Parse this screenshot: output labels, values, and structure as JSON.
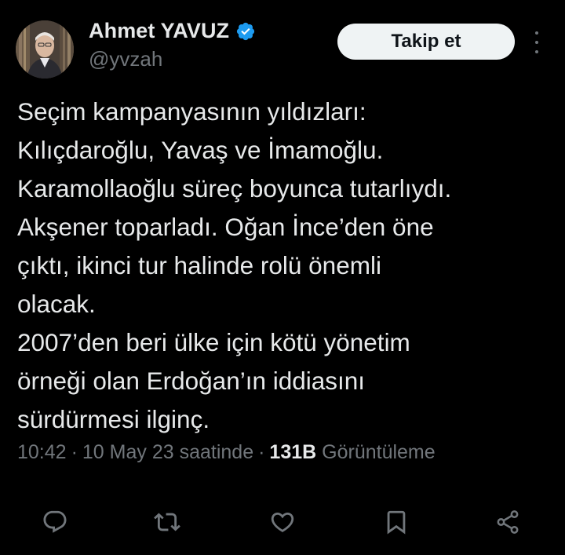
{
  "author": {
    "display_name": "Ahmet YAVUZ",
    "handle": "@yvzah",
    "verified": true
  },
  "follow_button": {
    "label": "Takip et"
  },
  "tweet": {
    "lines": [
      "Seçim kampanyasının yıldızları:",
      "Kılıçdaroğlu, Yavaş ve İmamoğlu.",
      "Karamollaoğlu süreç boyunca tutarlıydı.",
      "Akşener toparladı. Oğan İnce’den öne",
      "çıktı, ikinci tur halinde rolü önemli",
      "olacak.",
      "2007’den beri ülke için kötü yönetim",
      "örneği olan Erdoğan’ın iddiasını",
      "sürdürmesi ilginç."
    ]
  },
  "meta": {
    "time": "10:42",
    "separator": "·",
    "date": "10 May 23 saatinde",
    "views_count": "131B",
    "views_label": "Görüntüleme"
  },
  "actions": {
    "icons": [
      "reply-icon",
      "retweet-icon",
      "like-icon",
      "bookmark-icon",
      "share-icon"
    ]
  },
  "colors": {
    "background": "#000000",
    "text": "#e7e9ea",
    "secondary": "#71767b",
    "verified": "#1d9bf0",
    "button_bg": "#eff3f4"
  }
}
